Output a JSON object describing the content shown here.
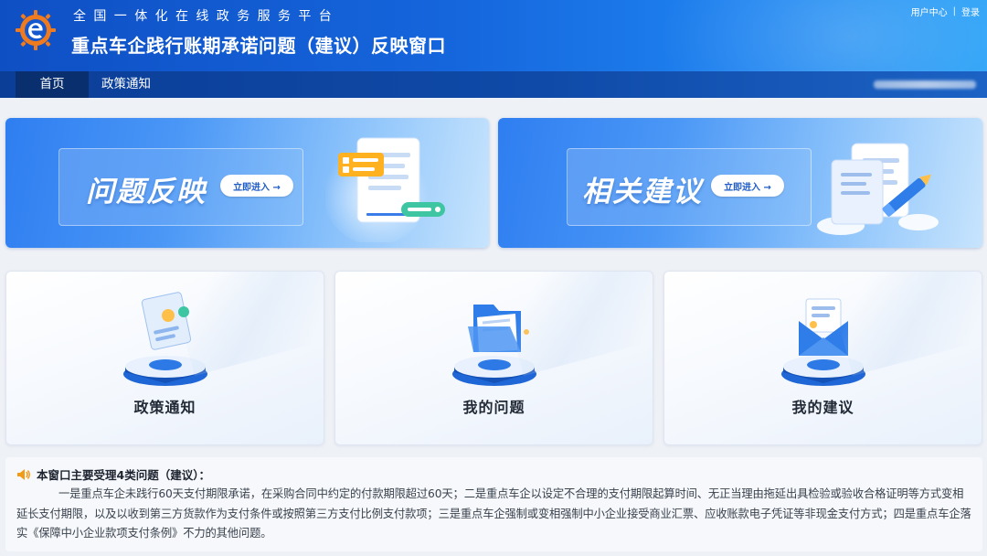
{
  "header": {
    "site_name": "全国一体化在线政务服务平台",
    "window_title": "重点车企践行账期承诺问题（建议）反映窗口",
    "user_center": "用户中心",
    "separator": "|",
    "login": "登录"
  },
  "nav": {
    "items": [
      {
        "label": "首页",
        "active": true
      },
      {
        "label": "政策通知",
        "active": false
      }
    ]
  },
  "banners": [
    {
      "label": "问题反映",
      "button": "立即进入 →",
      "icon": "document-form-illustration"
    },
    {
      "label": "相关建议",
      "button": "立即进入 →",
      "icon": "document-pen-illustration"
    }
  ],
  "cards": [
    {
      "label": "政策通知",
      "icon": "policy-certificate-illustration"
    },
    {
      "label": "我的问题",
      "icon": "folder-illustration"
    },
    {
      "label": "我的建议",
      "icon": "mail-envelope-illustration"
    }
  ],
  "notice": {
    "icon": "speaker-icon",
    "title": "本窗口主要受理4类问题（建议）：",
    "body": "一是重点车企未践行60天支付期限承诺，在采购合同中约定的付款期限超过60天；二是重点车企以设定不合理的支付期限起算时间、无正当理由拖延出具检验或验收合格证明等方式变相延长支付期限，以及以收到第三方货款作为支付条件或按照第三方支付比例支付款项；三是重点车企强制或变相强制中小企业接受商业汇票、应收账款电子凭证等非现金支付方式；四是重点车企落实《保障中小企业款项支付条例》不力的其他问题。"
  },
  "colors": {
    "header_start": "#0f4fc4",
    "header_end": "#2ea3f7",
    "nav_bg": "#0f4aa8",
    "nav_active": "#0a2f6f",
    "button_text": "#1f5cc8",
    "logo_orange": "#f07a1e"
  }
}
